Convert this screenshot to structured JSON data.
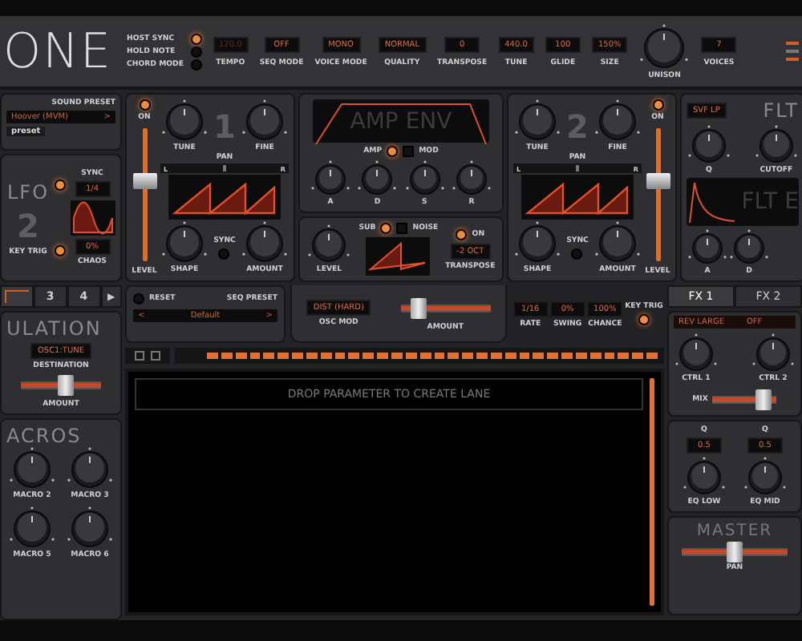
{
  "header": {
    "logo": "ONE",
    "toggles": [
      {
        "label": "HOST SYNC",
        "on": true
      },
      {
        "label": "HOLD NOTE",
        "on": false
      },
      {
        "label": "CHORD MODE",
        "on": false
      }
    ],
    "fields": [
      {
        "label": "TEMPO",
        "value": "120.0",
        "disabled": true
      },
      {
        "label": "SEQ MODE",
        "value": "OFF",
        "disabled": false
      },
      {
        "label": "VOICE MODE",
        "value": "MONO",
        "disabled": false
      },
      {
        "label": "QUALITY",
        "value": "NORMAL",
        "disabled": false
      },
      {
        "label": "TRANSPOSE",
        "value": "0",
        "disabled": false
      },
      {
        "label": "TUNE",
        "value": "440.0",
        "disabled": false
      },
      {
        "label": "GLIDE",
        "value": "100",
        "disabled": false
      },
      {
        "label": "SIZE",
        "value": "150%",
        "disabled": false
      }
    ],
    "unison": "UNISON",
    "voices": {
      "label": "VOICES",
      "value": "7"
    }
  },
  "sound_preset": {
    "label": "SOUND PRESET",
    "value": "Hoover (MVM)",
    "next": ">",
    "tag": "preset"
  },
  "lfo": {
    "title": "LFO",
    "number": "2",
    "sync": {
      "label": "SYNC",
      "on": true,
      "value": "1/4"
    },
    "key_trig": {
      "label": "KEY TRIG",
      "on": true
    },
    "chaos": {
      "label": "CHAOS",
      "value": "0%"
    }
  },
  "oscillators": [
    {
      "number": "1",
      "on_label": "ON",
      "on": true,
      "level_label": "LEVEL",
      "level": 0.6,
      "knobs": [
        "TUNE",
        "FINE"
      ],
      "pan": {
        "label": "PAN",
        "left": "L",
        "right": "R",
        "level": 0.5
      },
      "shape_label": "SHAPE",
      "sync_label": "SYNC",
      "sync_on": false,
      "amount_label": "AMOUNT"
    },
    {
      "number": "2",
      "on_label": "ON",
      "on": true,
      "level_label": "LEVEL",
      "level": 0.6,
      "knobs": [
        "TUNE",
        "FINE"
      ],
      "pan": {
        "label": "PAN",
        "left": "L",
        "right": "R",
        "level": 0.5
      },
      "shape_label": "SHAPE",
      "sync_label": "SYNC",
      "sync_on": false,
      "amount_label": "AMOUNT"
    }
  ],
  "amp_env": {
    "title": "AMP ENV",
    "switch": {
      "left": "AMP",
      "right": "MOD",
      "on": true
    },
    "knobs": [
      "A",
      "D",
      "S",
      "R"
    ]
  },
  "sub": {
    "level_label": "LEVEL",
    "switch": {
      "left": "SUB",
      "right": "NOISE",
      "on": true
    },
    "on_label": "ON",
    "on": true,
    "transpose": {
      "value": "-2 OCT",
      "label": "TRANSPOSE"
    }
  },
  "filter": {
    "type": "SVF LP",
    "title": "FLT",
    "knobs": [
      "Q",
      "CUTOFF"
    ],
    "env_title": "FLT E",
    "env_knobs": [
      "A",
      "D"
    ]
  },
  "mod_tabs": [
    {
      "selected": true
    },
    {
      "label": "3",
      "selected": false
    },
    {
      "label": "4",
      "selected": false
    }
  ],
  "mod_next": "▶",
  "modulation": {
    "title": "ULATION",
    "destination": {
      "value": "OSC1:TUNE",
      "label": "DESTINATION"
    },
    "amount": {
      "label": "AMOUNT",
      "level": 0.55
    }
  },
  "macros": {
    "title": "ACROS",
    "knobs": [
      "MACRO 2",
      "MACRO 3",
      "MACRO 5",
      "MACRO 6"
    ]
  },
  "sequencer": {
    "reset_label": "RESET",
    "preset_label": "SEQ PRESET",
    "preset": "Default",
    "prev": "<",
    "next": ">",
    "osc_mod": {
      "value": "DIST (HARD)",
      "label": "OSC MOD"
    },
    "amount": {
      "label": "AMOUNT",
      "level": 0.2
    },
    "params": [
      {
        "value": "1/16",
        "label": "RATE"
      },
      {
        "value": "0%",
        "label": "SWING"
      },
      {
        "value": "100%",
        "label": "CHANCE"
      }
    ],
    "key_trig": {
      "label": "KEY TRIG",
      "on": true
    },
    "steps": [
      {
        "on": true
      },
      {
        "on": true
      },
      {
        "on": true
      },
      {
        "on": true
      },
      {
        "on": true
      },
      {
        "on": true
      },
      {
        "on": true
      },
      {
        "on": true
      },
      {
        "on": true
      },
      {
        "on": true
      },
      {
        "on": true
      },
      {
        "on": true
      },
      {
        "on": true
      },
      {
        "on": true
      },
      {
        "on": true
      },
      {
        "on": true
      },
      {
        "on": true
      },
      {
        "on": true
      },
      {
        "on": true
      },
      {
        "on": true
      },
      {
        "on": true
      },
      {
        "on": true
      },
      {
        "on": true
      },
      {
        "on": true
      },
      {
        "on": true
      },
      {
        "on": true
      },
      {
        "on": true
      },
      {
        "on": true
      },
      {
        "on": true
      },
      {
        "on": true
      },
      {
        "on": true
      },
      {
        "on": true
      }
    ],
    "lane_hint": "DROP PARAMETER TO CREATE LANE"
  },
  "fx": {
    "tabs": [
      {
        "label": "FX 1",
        "selected": true
      },
      {
        "label": "FX 2",
        "selected": false
      }
    ],
    "effect": "REV LARGE",
    "state": "OFF",
    "knobs": [
      "CTRL 1",
      "CTRL 2"
    ],
    "mix": {
      "label": "MIX",
      "level": 0.8
    }
  },
  "eq": [
    {
      "label": "Q",
      "value": "0.5",
      "knob": "EQ LOW"
    },
    {
      "label": "Q",
      "value": "0.5",
      "knob": "EQ MID"
    }
  ],
  "master": {
    "title": "MASTER",
    "pan": {
      "label": "PAN",
      "level": 0.5
    }
  }
}
